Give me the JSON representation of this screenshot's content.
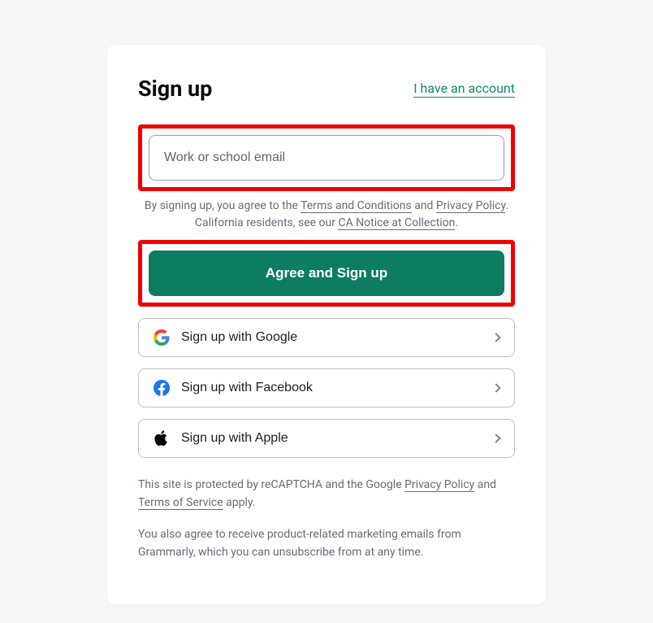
{
  "header": {
    "title": "Sign up",
    "account_link": "I have an account"
  },
  "email": {
    "placeholder": "Work or school email"
  },
  "legal_top": {
    "prefix": "By signing up, you agree to the ",
    "terms": "Terms and Conditions",
    "mid1": " and ",
    "privacy": "Privacy Policy",
    "suffix1": ". California residents, see our ",
    "ca_notice": "CA Notice at Collection",
    "suffix2": "."
  },
  "primary_button": "Agree and Sign up",
  "oauth": {
    "google": "Sign up with Google",
    "facebook": "Sign up with Facebook",
    "apple": "Sign up with Apple"
  },
  "legal_bottom": {
    "recaptcha_prefix": "This site is protected by reCAPTCHA and the Google ",
    "privacy": "Privacy Policy",
    "mid": " and ",
    "tos": "Terms of Service",
    "suffix": " apply.",
    "marketing": "You also agree to receive product-related marketing emails from Grammarly, which you can unsubscribe from at any time."
  }
}
